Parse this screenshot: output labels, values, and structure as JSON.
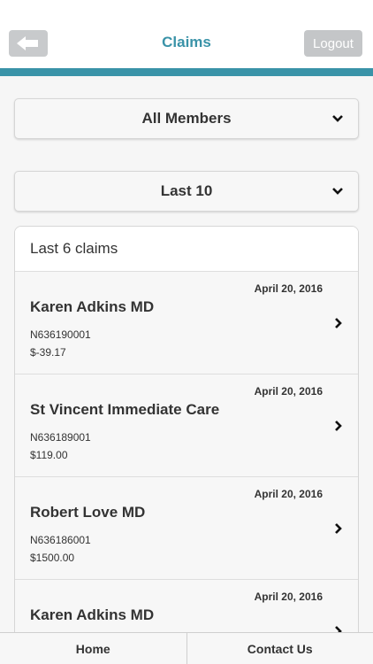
{
  "header": {
    "title": "Claims",
    "back_icon": "back-arrow-icon",
    "logout_label": "Logout"
  },
  "colors": {
    "accent": "#3a93a8",
    "button_gray": "#c4c6c8"
  },
  "filters": {
    "member": {
      "selected": "All Members",
      "icon": "chevron-down-icon"
    },
    "range": {
      "selected": "Last 10",
      "icon": "chevron-down-icon"
    }
  },
  "claims": {
    "summary": "Last 6 claims",
    "items": [
      {
        "date": "April 20, 2016",
        "provider": "Karen Adkins MD",
        "claim_no": "N636190001",
        "amount": "$-39.17"
      },
      {
        "date": "April 20, 2016",
        "provider": "St Vincent Immediate Care",
        "claim_no": "N636189001",
        "amount": "$119.00"
      },
      {
        "date": "April 20, 2016",
        "provider": "Robert Love MD",
        "claim_no": "N636186001",
        "amount": "$1500.00"
      },
      {
        "date": "April 20, 2016",
        "provider": "Karen Adkins MD",
        "claim_no": "",
        "amount": ""
      }
    ]
  },
  "tabbar": {
    "home_label": "Home",
    "contact_label": "Contact Us"
  }
}
